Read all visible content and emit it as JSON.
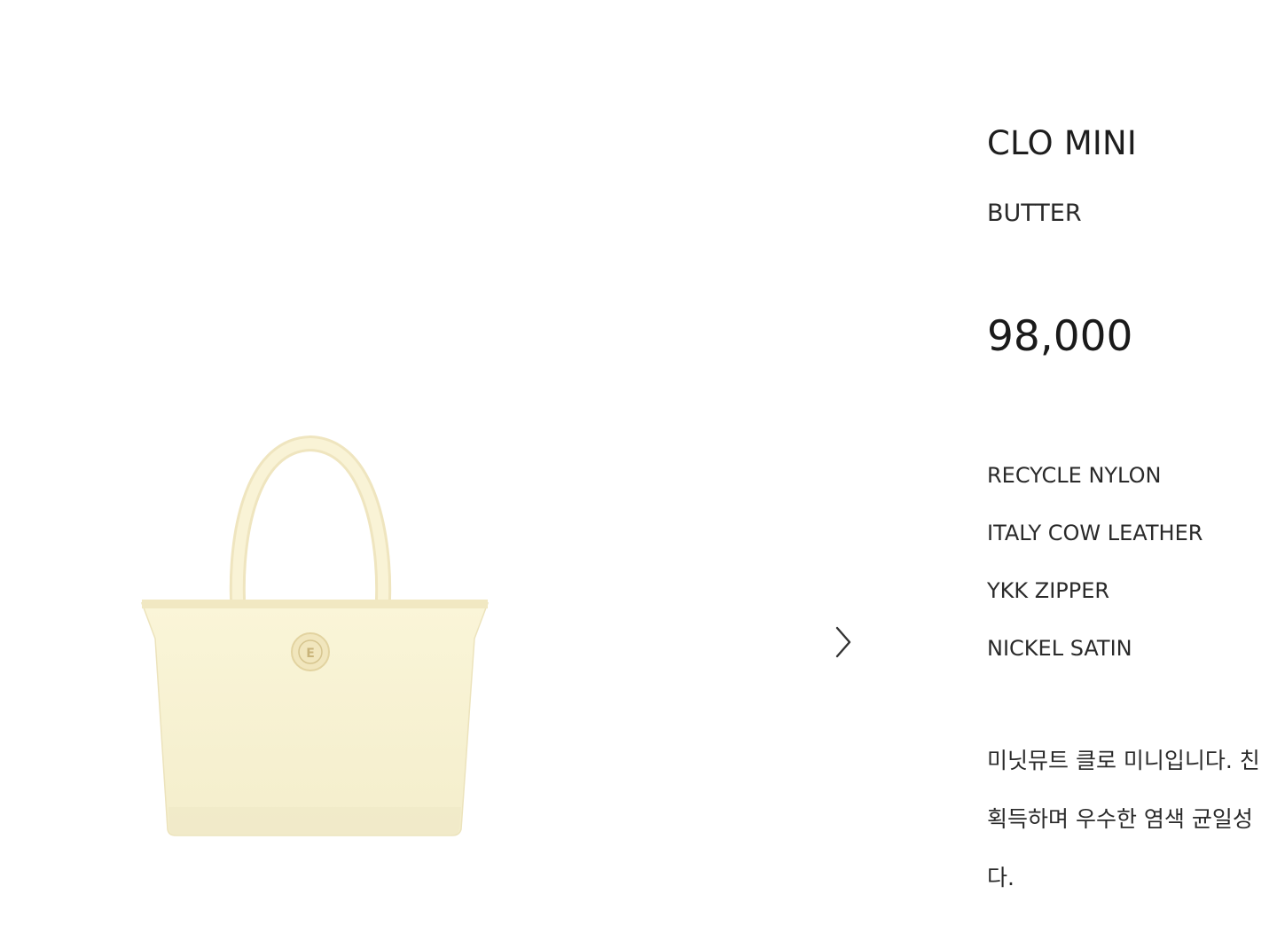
{
  "product": {
    "name": "CLO MINI",
    "color": "BUTTER",
    "price": "98,000",
    "materials": [
      "RECYCLE NYLON",
      "ITALY COW LEATHER",
      "YKK ZIPPER",
      "NICKEL SATIN"
    ],
    "description_lines": [
      "미닛뮤트 클로 미니입니다. 친",
      "획득하며 우수한 염색 균일성",
      "다."
    ]
  },
  "gallery": {
    "next_icon": "chevron-right-icon",
    "image_logo_text": "E"
  },
  "colors": {
    "bag_body": "#f8f3d3",
    "bag_trim": "#f1e8c2",
    "text": "#222222"
  }
}
